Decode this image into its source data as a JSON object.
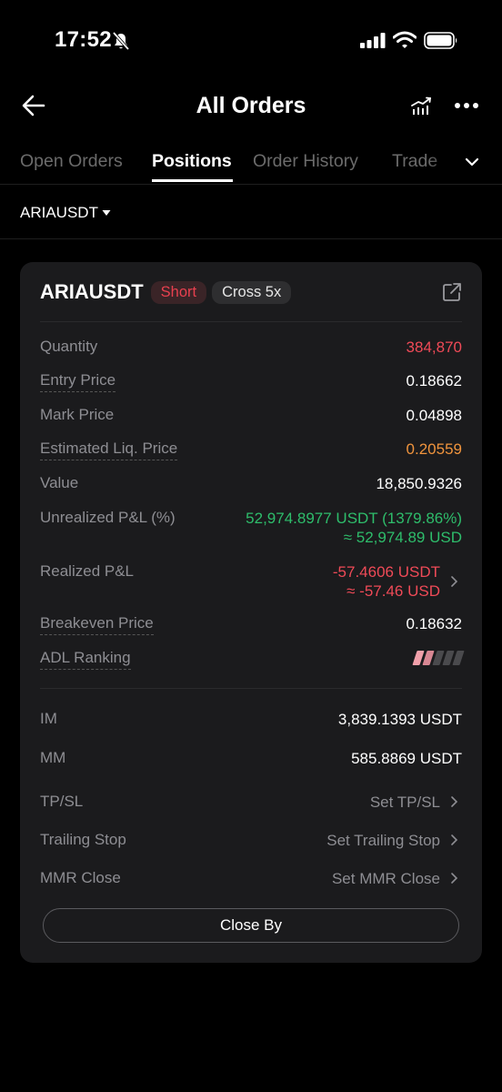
{
  "status_bar": {
    "time": "17:52"
  },
  "header": {
    "title": "All Orders"
  },
  "tabs": [
    {
      "label": "Open Orders",
      "active": false
    },
    {
      "label": "Positions",
      "active": true
    },
    {
      "label": "Order History",
      "active": false
    },
    {
      "label": "Trade",
      "active": false
    }
  ],
  "filter": {
    "symbol": "ARIAUSDT"
  },
  "position": {
    "symbol": "ARIAUSDT",
    "side": "Short",
    "margin_mode": "Cross 5x",
    "rows": {
      "quantity": {
        "label": "Quantity",
        "value": "384,870"
      },
      "entry_price": {
        "label": "Entry Price",
        "value": "0.18662"
      },
      "mark_price": {
        "label": "Mark Price",
        "value": "0.04898"
      },
      "liq_price": {
        "label": "Estimated Liq. Price",
        "value": "0.20559"
      },
      "value": {
        "label": "Value",
        "value": "18,850.9326"
      },
      "unrealized_pnl": {
        "label": "Unrealized P&L (%)",
        "value": "52,974.8977 USDT (1379.86%)",
        "value_usd": "≈ 52,974.89 USD"
      },
      "realized_pnl": {
        "label": "Realized P&L",
        "value": "-57.4606 USDT",
        "value_usd": "≈ -57.46 USD"
      },
      "breakeven": {
        "label": "Breakeven Price",
        "value": "0.18632"
      },
      "adl": {
        "label": "ADL Ranking",
        "level": 2,
        "max": 5
      },
      "im": {
        "label": "IM",
        "value": "3,839.1393 USDT"
      },
      "mm": {
        "label": "MM",
        "value": "585.8869 USDT"
      },
      "tpsl": {
        "label": "TP/SL",
        "value": "Set TP/SL"
      },
      "trailing": {
        "label": "Trailing Stop",
        "value": "Set Trailing Stop"
      },
      "mmr_close": {
        "label": "MMR Close",
        "value": "Set MMR Close"
      }
    },
    "close_button": "Close By"
  },
  "colors": {
    "red": "#ef4a57",
    "green": "#2ebd6b",
    "orange": "#f0943d",
    "card_bg": "#1b1b1d"
  }
}
